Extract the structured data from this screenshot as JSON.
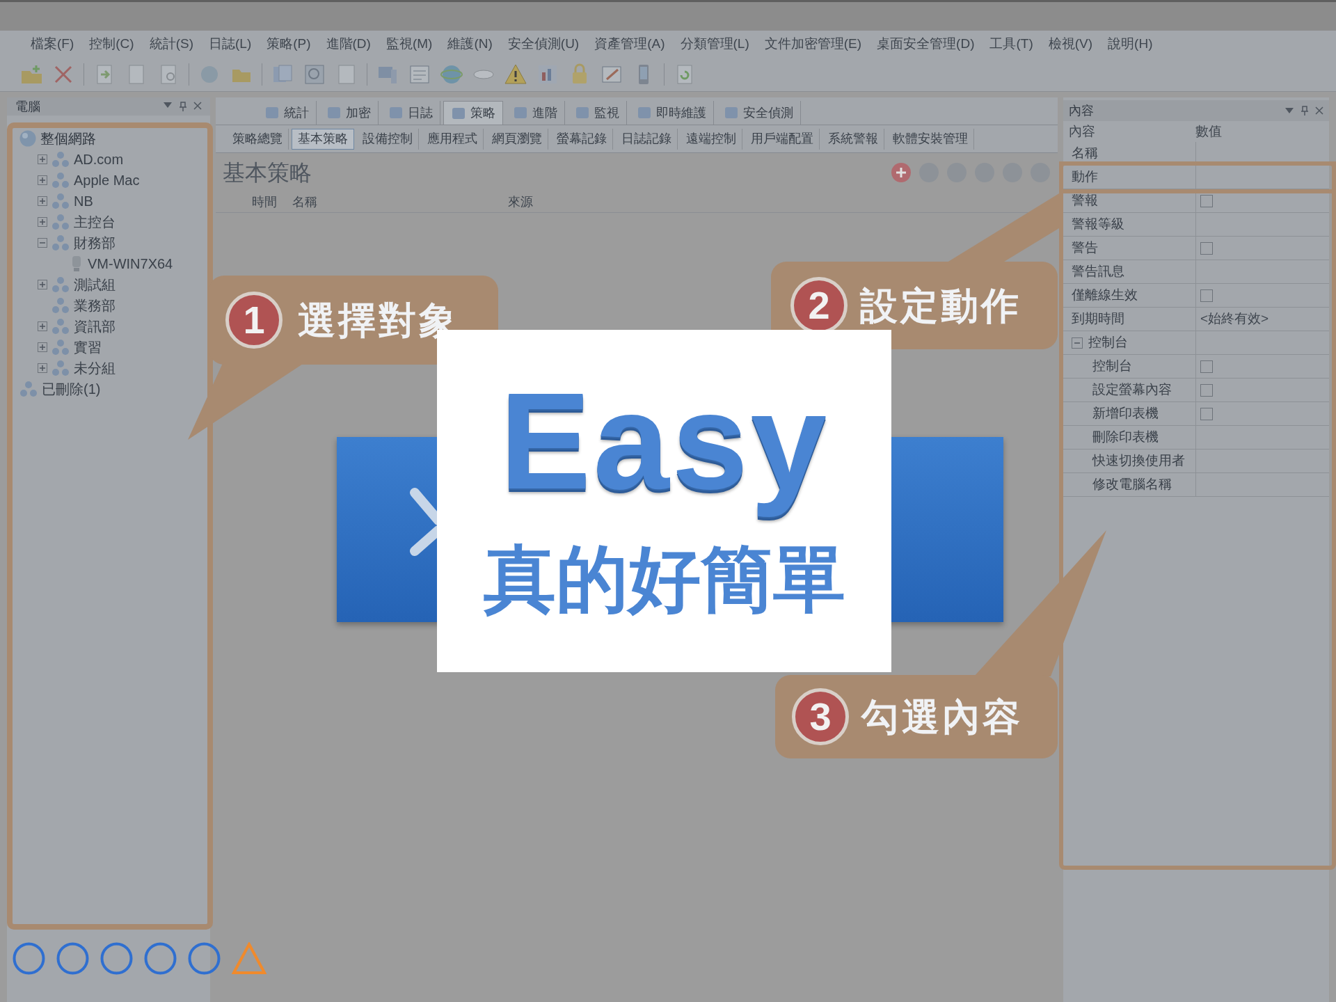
{
  "menu": [
    "檔案(F)",
    "控制(C)",
    "統計(S)",
    "日誌(L)",
    "策略(P)",
    "進階(D)",
    "監視(M)",
    "維護(N)",
    "安全偵測(U)",
    "資產管理(A)",
    "分類管理(L)",
    "文件加密管理(E)",
    "桌面安全管理(D)",
    "工具(T)",
    "檢視(V)",
    "說明(H)"
  ],
  "left_panel": {
    "title": "電腦",
    "tree": [
      {
        "label": "整個網路",
        "children": [
          {
            "label": "AD.com",
            "expanded": false
          },
          {
            "label": "Apple Mac",
            "expanded": false
          },
          {
            "label": "NB",
            "expanded": false
          },
          {
            "label": "主控台",
            "expanded": false
          },
          {
            "label": "財務部",
            "expanded": true,
            "children": [
              {
                "label": "VM-WIN7X64",
                "kind": "computer"
              }
            ]
          },
          {
            "label": "測試組",
            "expanded": false
          },
          {
            "label": "業務部"
          },
          {
            "label": "資訊部",
            "expanded": false
          },
          {
            "label": "實習",
            "expanded": false
          },
          {
            "label": "未分組",
            "expanded": false
          }
        ]
      },
      {
        "label": "已刪除(1)"
      }
    ]
  },
  "tabs": [
    {
      "label": "統計",
      "selected": false
    },
    {
      "label": "加密",
      "selected": false
    },
    {
      "label": "日誌",
      "selected": false
    },
    {
      "label": "策略",
      "selected": true
    },
    {
      "label": "進階",
      "selected": false
    },
    {
      "label": "監視",
      "selected": false
    },
    {
      "label": "即時維護",
      "selected": false
    },
    {
      "label": "安全偵測",
      "selected": false
    }
  ],
  "subtabs": [
    {
      "label": "策略總覽",
      "selected": false
    },
    {
      "label": "基本策略",
      "selected": true
    },
    {
      "label": "設備控制",
      "selected": false
    },
    {
      "label": "應用程式",
      "selected": false
    },
    {
      "label": "網頁瀏覽",
      "selected": false
    },
    {
      "label": "螢幕記錄",
      "selected": false
    },
    {
      "label": "日誌記錄",
      "selected": false
    },
    {
      "label": "遠端控制",
      "selected": false
    },
    {
      "label": "用戶端配置",
      "selected": false
    },
    {
      "label": "系統警報",
      "selected": false
    },
    {
      "label": "軟體安裝管理",
      "selected": false
    }
  ],
  "policy": {
    "title": "基本策略",
    "columns": [
      "時間",
      "名稱",
      "來源"
    ]
  },
  "right_panel": {
    "title": "內容",
    "columns": [
      "內容",
      "數值"
    ],
    "rows": [
      {
        "label": "名稱",
        "kind": "text"
      },
      {
        "label": "動作",
        "kind": "text"
      },
      {
        "label": "警報",
        "kind": "checkbox",
        "checked": false
      },
      {
        "label": "警報等級",
        "kind": "text"
      },
      {
        "label": "警告",
        "kind": "checkbox",
        "checked": false
      },
      {
        "label": "警告訊息",
        "kind": "text"
      },
      {
        "label": "僅離線生效",
        "kind": "checkbox",
        "checked": false
      },
      {
        "label": "到期時間",
        "kind": "text",
        "value": "<始終有效>"
      },
      {
        "label": "控制台",
        "kind": "group",
        "expanded": true,
        "children": [
          {
            "label": "控制台",
            "kind": "checkbox",
            "checked": false
          },
          {
            "label": "設定螢幕內容",
            "kind": "checkbox",
            "checked": false
          },
          {
            "label": "新增印表機",
            "kind": "checkbox",
            "checked": false
          },
          {
            "label": "刪除印表機",
            "kind": "text"
          },
          {
            "label": "快速切換使用者",
            "kind": "text"
          },
          {
            "label": "修改電腦名稱",
            "kind": "text"
          }
        ]
      }
    ]
  },
  "callouts": [
    {
      "number": "1",
      "label": "選擇對象"
    },
    {
      "number": "2",
      "label": "設定動作"
    },
    {
      "number": "3",
      "label": "勾選內容"
    }
  ],
  "card": {
    "headline": "Easy",
    "subtitle": "真的好簡單"
  },
  "progress_marks": [
    {
      "kind": "circle"
    },
    {
      "kind": "circle"
    },
    {
      "kind": "circle"
    },
    {
      "kind": "circle"
    },
    {
      "kind": "circle"
    },
    {
      "kind": "triangle"
    }
  ]
}
